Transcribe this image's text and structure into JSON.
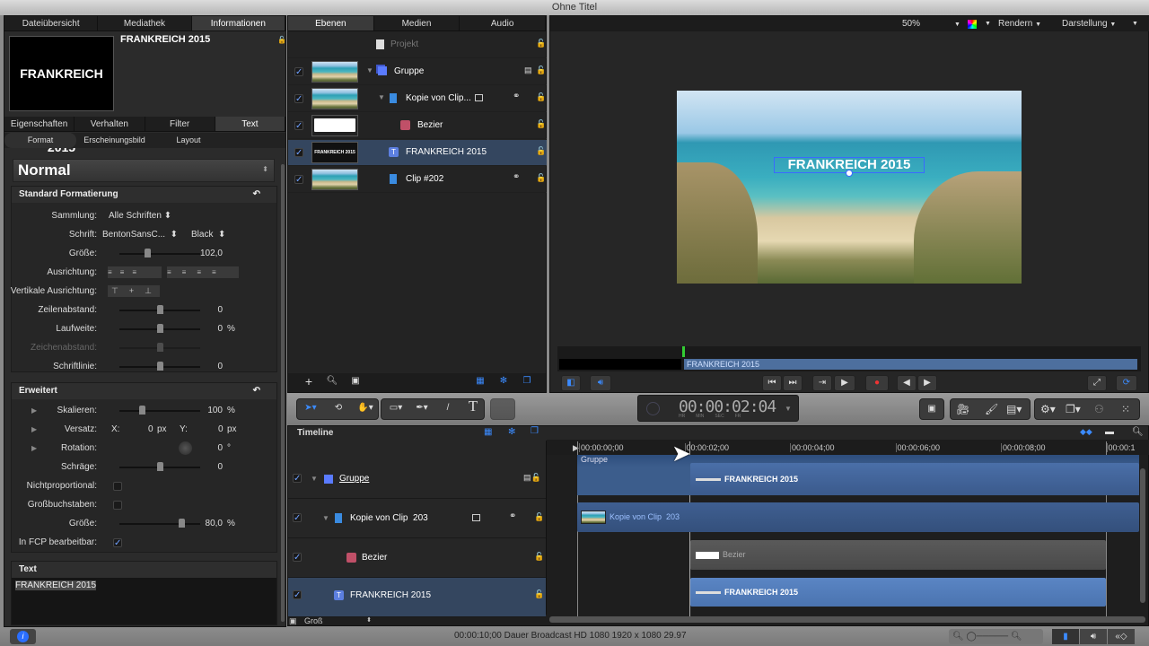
{
  "window": {
    "title": "Ohne Titel"
  },
  "left": {
    "tabs": [
      "Dateiübersicht",
      "Mediathek",
      "Informationen"
    ],
    "active_tab": "Informationen",
    "preview_text": "FRANKREICH 2015",
    "object_name": "FRANKREICH 2015",
    "inspector_tabs": [
      "Eigenschaften",
      "Verhalten",
      "Filter",
      "Text"
    ],
    "active_inspector_tab": "Text",
    "sub_tabs": [
      "Format",
      "Erscheinungsbild",
      "Layout"
    ],
    "preset": "Normal",
    "standard": {
      "title": "Standard Formatierung",
      "sammlung_label": "Sammlung:",
      "sammlung": "Alle Schriften",
      "schrift_label": "Schrift:",
      "schrift": "BentonSansC...",
      "schnitt": "Black",
      "groesse_label": "Größe:",
      "groesse": "102,0",
      "ausrichtung_label": "Ausrichtung:",
      "vert_label": "Vertikale Ausrichtung:",
      "zeilen_label": "Zeilenabstand:",
      "zeilen": "0",
      "lauf_label": "Laufweite:",
      "lauf": "0",
      "lauf_unit": "%",
      "zeichen_label": "Zeichenabstand:",
      "linie_label": "Schriftlinie:",
      "linie": "0"
    },
    "erweitert": {
      "title": "Erweitert",
      "skal_label": "Skalieren:",
      "skal": "100",
      "skal_unit": "%",
      "versatz_label": "Versatz:",
      "x_label": "X:",
      "x": "0",
      "y_label": "Y:",
      "y": "0",
      "px": "px",
      "rot_label": "Rotation:",
      "rot": "0",
      "rot_unit": "°",
      "schraege_label": "Schräge:",
      "schraege": "0",
      "nichtprop_label": "Nichtproportional:",
      "nichtprop": false,
      "gross_label": "Großbuchstaben:",
      "gross": false,
      "groesse_label": "Größe:",
      "groesse": "80,0",
      "groesse_unit": "%",
      "fcp_label": "In FCP bearbeitbar:",
      "fcp": true
    },
    "text_section": {
      "title": "Text",
      "value": "FRANKREICH 2015"
    }
  },
  "layers": {
    "tabs": [
      "Ebenen",
      "Medien",
      "Audio"
    ],
    "active_tab": "Ebenen",
    "project": "Projekt",
    "items": [
      {
        "name": "Gruppe",
        "checked": true,
        "selected": false
      },
      {
        "name": "Kopie von Clip...",
        "checked": true,
        "selected": false
      },
      {
        "name": "Bezier",
        "checked": true,
        "selected": false
      },
      {
        "name": "FRANKREICH 2015",
        "checked": true,
        "selected": true
      },
      {
        "name": "Clip #202",
        "checked": true,
        "selected": false
      }
    ],
    "thumb_text": "FRANKREICH 2015"
  },
  "canvas": {
    "zoom": "50%",
    "render": "Rendern",
    "view": "Darstellung",
    "overlay_text": "FRANKREICH 2015",
    "mini_timeline_label": "FRANKREICH 2015"
  },
  "timecode": {
    "value": "00:00:02:04",
    "units": [
      "HR",
      "MIN",
      "SEC",
      "FR"
    ]
  },
  "timeline": {
    "title": "Timeline",
    "ticks": [
      "00:00:00;00",
      "00:00:02;00",
      "00:00:04;00",
      "00:00:06;00",
      "00:00:08;00",
      "00:00:1"
    ],
    "group_label": "Gruppe",
    "tracks": [
      {
        "name": "Gruppe",
        "checked": true
      },
      {
        "name": "Kopie von Clip  203",
        "checked": true
      },
      {
        "name": "Bezier",
        "checked": true
      },
      {
        "name": "FRANKREICH 2015",
        "checked": true
      }
    ],
    "bars": [
      "FRANKREICH 2015",
      "Kopie von Clip  203",
      "Bezier",
      "FRANKREICH 2015"
    ],
    "size_select": "Groß"
  },
  "status": {
    "text": "00:00:10;00 Dauer Broadcast HD 1080 1920 x 1080 29.97"
  }
}
